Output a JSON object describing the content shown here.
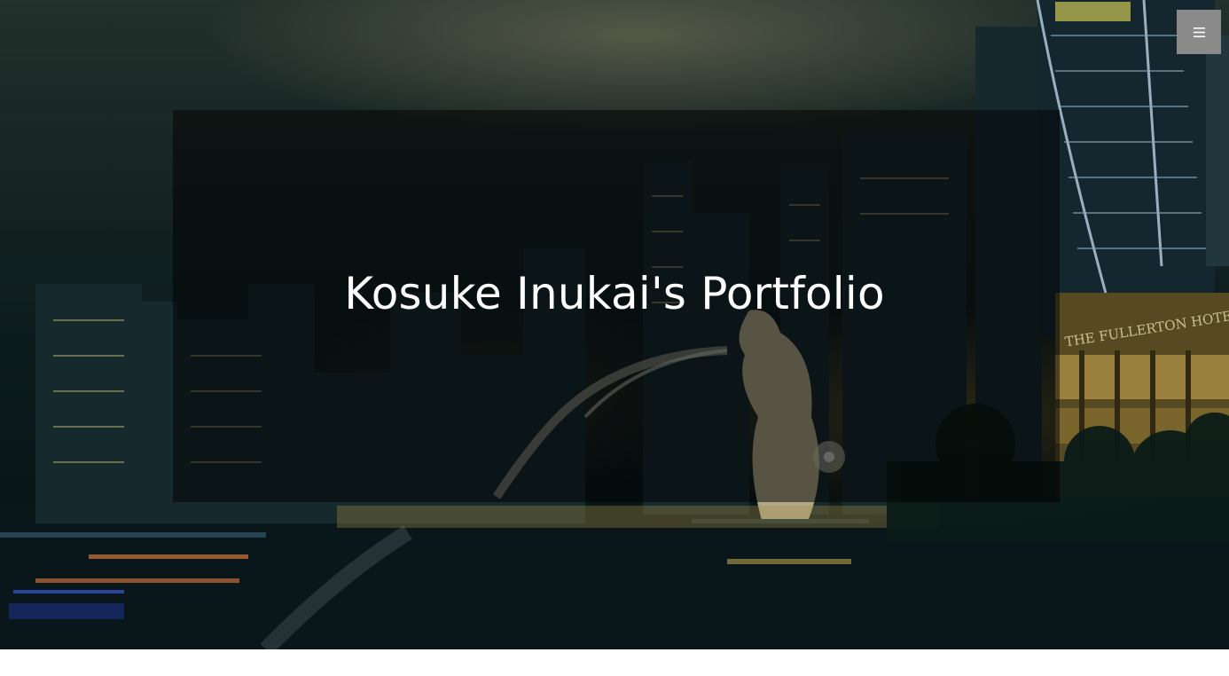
{
  "hero": {
    "title": "Kosuke Inukai's Portfolio",
    "background_image_label": "THE FULLERTON HOTEL"
  },
  "nav": {
    "menu_icon": "hamburger-menu-icon"
  },
  "colors": {
    "title_text": "#ffffff",
    "title_box": "rgba(0,0,0,0.5)",
    "menu_button": "#8a8a8a",
    "page_background": "#ffffff"
  }
}
